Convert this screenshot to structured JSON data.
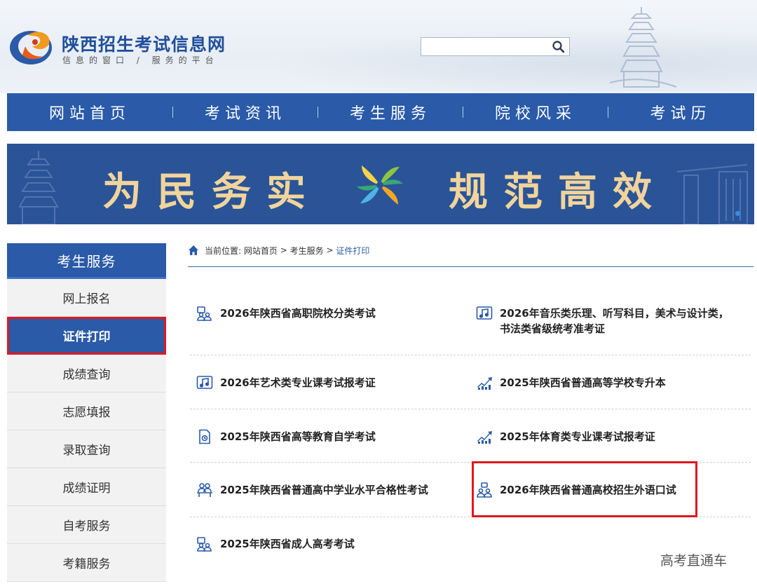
{
  "header": {
    "site_title": "陕西招生考试信息网",
    "slogan": "信息的窗口 / 服务的平台",
    "search_placeholder": ""
  },
  "nav": {
    "items": [
      "网站首页",
      "考试资讯",
      "考生服务",
      "院校风采",
      "考试历"
    ]
  },
  "banner": {
    "left_text": "为民务实",
    "right_text": "规范高效"
  },
  "sidebar": {
    "title": "考生服务",
    "items": [
      "网上报名",
      "证件打印",
      "成绩查询",
      "志愿填报",
      "录取查询",
      "成绩证明",
      "自考服务",
      "考籍服务"
    ],
    "active_index": 1
  },
  "breadcrumb": {
    "prefix": "当前位置:",
    "home": "网站首页",
    "sep": ">",
    "section": "考生服务",
    "current": "证件打印"
  },
  "exams": [
    {
      "label": "2026年陕西省高职院校分类考试",
      "icon": "people-card-icon"
    },
    {
      "label": "2026年音乐类乐理、听写科目，美术与设计类，书法类省级统考准考证",
      "icon": "music-icon"
    },
    {
      "label": "2026年艺术类专业课考试报考证",
      "icon": "music-icon"
    },
    {
      "label": "2025年陕西省普通高等学校专升本",
      "icon": "trend-up-icon"
    },
    {
      "label": "2025年陕西省高等教育自学考试",
      "icon": "document-icon"
    },
    {
      "label": "2025年体育类专业课考试报考证",
      "icon": "trend-up-icon"
    },
    {
      "label": "2025年陕西省普通高中学业水平合格性考试",
      "icon": "students-desk-icon"
    },
    {
      "label": "2026年陕西省普通高校招生外语口试",
      "icon": "people-presentation-icon"
    },
    {
      "label": "2025年陕西省成人高考考试",
      "icon": "people-card-icon"
    }
  ],
  "watermark": "高考直通车",
  "colors": {
    "primary_blue": "#2a5aa8",
    "banner_gold": "#f1d49c",
    "highlight_red": "#e0181c"
  }
}
